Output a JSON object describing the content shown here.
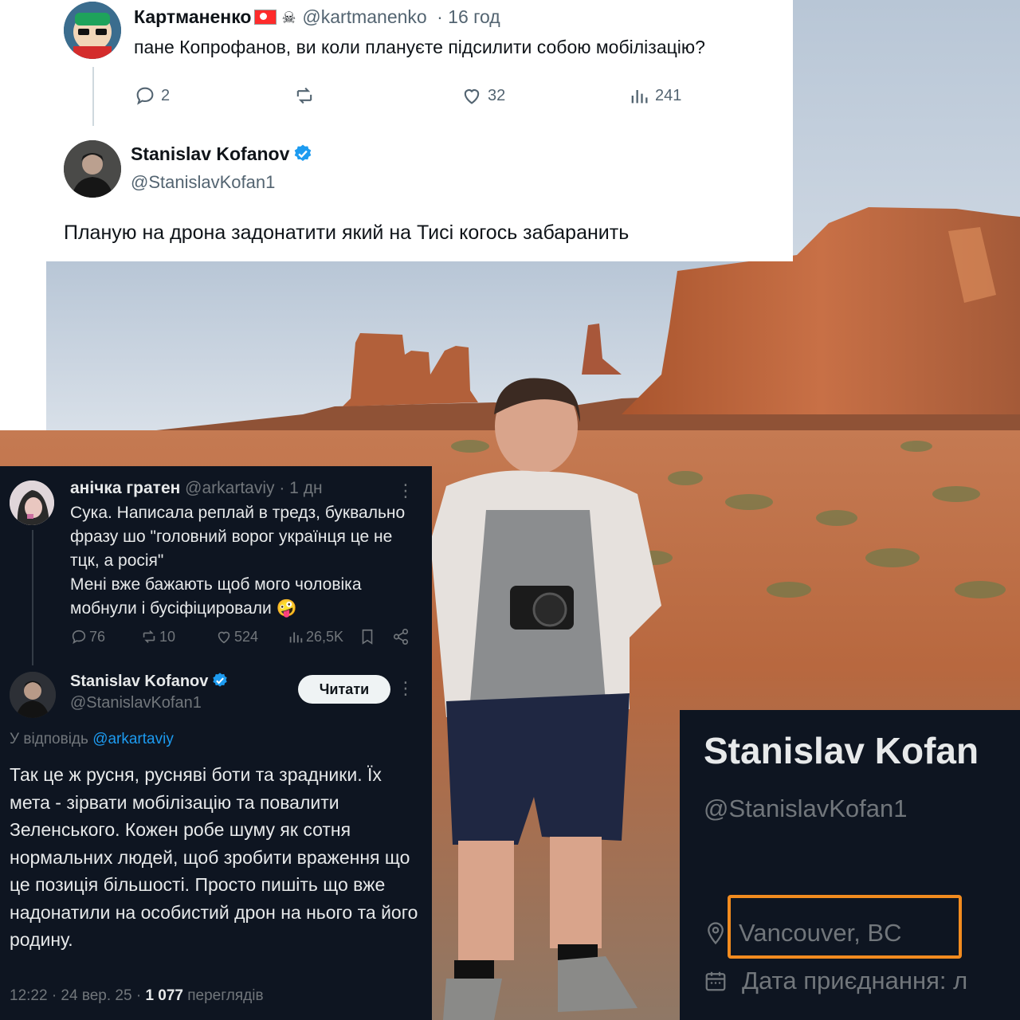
{
  "top_tweet": {
    "reply": {
      "author_name": "Картманенко",
      "flag_icon": "north-korea-flag-icon",
      "extra_icon": "skull-crossbones-icon",
      "handle": "@kartmanenko",
      "time": "· 16 год",
      "text": "пане Копрофанов, ви коли плануєте підсилити собою мобілізацію?",
      "replies": "2",
      "likes": "32",
      "views": "241"
    },
    "main": {
      "author_name": "Stanislav Kofanov",
      "handle": "@StanislavKofan1",
      "text": "Планую на дрона задонатити який на Тисі когось забаранить"
    }
  },
  "dark_thread": {
    "original": {
      "author_name": "анічка гратен",
      "handle_time": "@arkartaviy · 1 дн",
      "text": "Сука. Написала реплай в тредз, буквально фразу шо \"головний ворог українця це не тцк, а росія\"\nМені вже бажають щоб мого чоловіка мобнули і бусіфіцировали 🤪",
      "replies": "76",
      "reposts": "10",
      "likes": "524",
      "views": "26,5K"
    },
    "reply": {
      "author_name": "Stanislav Kofanov",
      "handle": "@StanislavKofan1",
      "follow_label": "Читати",
      "reply_to_prefix": "У відповідь",
      "reply_to_mention": "@arkartaviy",
      "text": "Так це ж русня, русняві боти та зрадники. Їх мета - зірвати мобілізацію та повалити Зеленського. Кожен робе шуму як сотня нормальних людей, щоб зробити враження що це позиція більшості. Просто пишіть що вже надонатили на особистий дрон  на нього та його родину.",
      "time": "12:22 · 24 вер. 25 · ",
      "views_count": "1 077",
      "views_label": " переглядів"
    }
  },
  "profile": {
    "name": "Stanislav Kofan",
    "handle": "@StanislavKofan1",
    "location": "Vancouver, BC",
    "joined": "Дата приєднання: л",
    "highlight_color": "#f28b1f"
  },
  "colors": {
    "verified": "#1d9bf0",
    "dark_bg": "#0e1521",
    "sky": "#c9d6e3",
    "ground": "#b5623f"
  }
}
